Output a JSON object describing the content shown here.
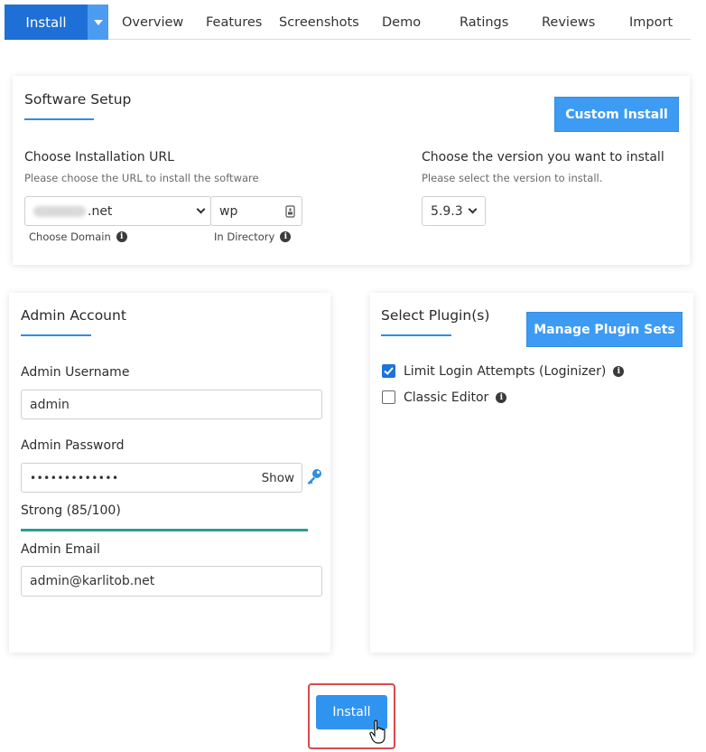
{
  "tabs": {
    "install": "Install",
    "items": [
      "Overview",
      "Features",
      "Screenshots",
      "Demo",
      "Ratings",
      "Reviews",
      "Import"
    ]
  },
  "software_setup": {
    "title": "Software Setup",
    "custom_install": "Custom Install",
    "url_label": "Choose Installation URL",
    "url_help": "Please choose the URL to install the software",
    "domain_value": ".net",
    "domain_label": "Choose Domain",
    "directory_value": "wp",
    "directory_label": "In Directory",
    "version_label": "Choose the version you want to install",
    "version_help": "Please select the version to install.",
    "version_value": "5.9.3"
  },
  "admin_account": {
    "title": "Admin Account",
    "username_label": "Admin Username",
    "username_value": "admin",
    "password_label": "Admin Password",
    "password_value": "•••••••••••••",
    "show_label": "Show",
    "strength": "Strong (85/100)",
    "strength_pct": 100,
    "email_label": "Admin Email",
    "email_value": "admin@karlitob.net"
  },
  "plugins": {
    "title": "Select Plugin(s)",
    "manage_button": "Manage Plugin Sets",
    "items": [
      {
        "label": "Limit Login Attempts (Loginizer)",
        "checked": true
      },
      {
        "label": "Classic Editor",
        "checked": false
      }
    ]
  },
  "footer": {
    "install_button": "Install"
  },
  "colors": {
    "tab_active": "#1e6fd6",
    "accent": "#3d9bf3",
    "strength": "#2a9d8f",
    "highlight_border": "#d84a4a"
  }
}
